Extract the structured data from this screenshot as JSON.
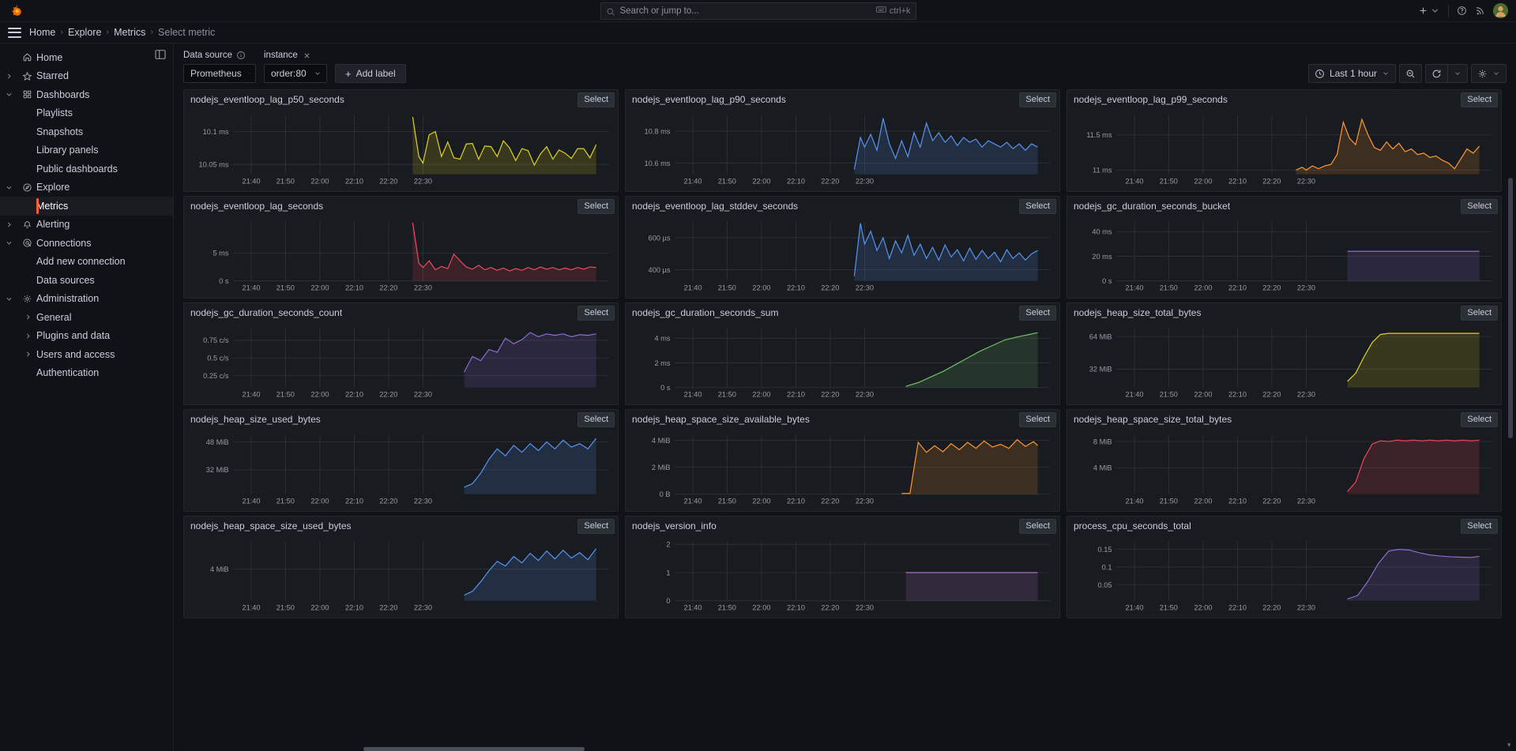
{
  "topbar": {
    "logo_icon": "grafana-logo-icon",
    "search_placeholder": "Search or jump to...",
    "search_icon": "search-icon",
    "kbd_hint": "ctrl+k",
    "kbd_icon": "keyboard-icon",
    "add_icon": "plus-icon",
    "help_icon": "question-circle-icon",
    "news_icon": "rss-icon",
    "avatar_icon": "user-avatar"
  },
  "breadcrumb": {
    "menu_icon": "hamburger-menu-icon",
    "items": [
      {
        "label": "Home",
        "current": false
      },
      {
        "label": "Explore",
        "current": false
      },
      {
        "label": "Metrics",
        "current": false
      },
      {
        "label": "Select metric",
        "current": true
      }
    ],
    "separator": "›"
  },
  "sidebar": {
    "collapse_icon": "dock-menu-icon",
    "items": [
      {
        "label": "Home",
        "icon": "home-icon",
        "level": 1,
        "chevron": "none",
        "active": false
      },
      {
        "label": "Starred",
        "icon": "star-icon",
        "level": 1,
        "chevron": "right",
        "active": false
      },
      {
        "label": "Dashboards",
        "icon": "apps-icon",
        "level": 1,
        "chevron": "down",
        "active": false
      },
      {
        "label": "Playlists",
        "icon": "",
        "level": 2,
        "chevron": "none",
        "active": false
      },
      {
        "label": "Snapshots",
        "icon": "",
        "level": 2,
        "chevron": "none",
        "active": false
      },
      {
        "label": "Library panels",
        "icon": "",
        "level": 2,
        "chevron": "none",
        "active": false
      },
      {
        "label": "Public dashboards",
        "icon": "",
        "level": 2,
        "chevron": "none",
        "active": false
      },
      {
        "label": "Explore",
        "icon": "compass-icon",
        "level": 1,
        "chevron": "down",
        "active": false
      },
      {
        "label": "Metrics",
        "icon": "",
        "level": 2,
        "chevron": "none",
        "active": true
      },
      {
        "label": "Alerting",
        "icon": "bell-icon",
        "level": 1,
        "chevron": "right",
        "active": false
      },
      {
        "label": "Connections",
        "icon": "connections-icon",
        "level": 1,
        "chevron": "down",
        "active": false
      },
      {
        "label": "Add new connection",
        "icon": "",
        "level": 2,
        "chevron": "none",
        "active": false
      },
      {
        "label": "Data sources",
        "icon": "",
        "level": 2,
        "chevron": "none",
        "active": false
      },
      {
        "label": "Administration",
        "icon": "gear-icon",
        "level": 1,
        "chevron": "down",
        "active": false
      },
      {
        "label": "General",
        "icon": "",
        "level": 3,
        "chevron": "right",
        "active": false
      },
      {
        "label": "Plugins and data",
        "icon": "",
        "level": 3,
        "chevron": "right",
        "active": false
      },
      {
        "label": "Users and access",
        "icon": "",
        "level": 3,
        "chevron": "right",
        "active": false
      },
      {
        "label": "Authentication",
        "icon": "",
        "level": 2,
        "chevron": "none",
        "active": false
      }
    ]
  },
  "controls": {
    "datasource_label": "Data source",
    "datasource_info_icon": "info-circle-icon",
    "datasource_value": "Prometheus",
    "instance_label": "instance",
    "instance_remove_icon": "close-icon",
    "instance_value": "order:80",
    "add_label_button": "Add label",
    "add_label_icon": "plus-icon",
    "time_range": "Last 1 hour",
    "time_icon": "clock-icon",
    "zoom_out_icon": "zoom-out-icon",
    "refresh_icon": "refresh-icon",
    "settings_icon": "gear-icon"
  },
  "panel_select_label": "Select",
  "chart_data": [
    {
      "type": "area",
      "title": "nodejs_eventloop_lag_p50_seconds",
      "color": "#e0d321",
      "ylabel": "",
      "xlabel": "",
      "yticks": [
        "10.05 ms",
        "10.1 ms"
      ],
      "ytick_values": [
        10.05,
        10.1
      ],
      "ylim": [
        10.035,
        10.125
      ],
      "xticks": [
        "21:40",
        "21:50",
        "22:00",
        "22:10",
        "22:20",
        "22:30"
      ],
      "x": [
        22.45,
        22.48,
        22.5,
        22.53,
        22.56,
        22.59,
        22.62,
        22.65,
        22.68,
        22.71,
        22.74,
        22.77,
        22.8,
        22.83,
        22.86,
        22.89,
        22.92,
        22.95,
        22.98,
        23.01,
        23.04,
        23.07,
        23.1,
        23.13,
        23.16,
        23.19,
        23.22,
        23.25,
        23.28,
        23.31,
        23.34
      ],
      "values": [
        10.122,
        10.062,
        10.052,
        10.095,
        10.1,
        10.062,
        10.084,
        10.06,
        10.058,
        10.081,
        10.082,
        10.058,
        10.078,
        10.077,
        10.062,
        10.086,
        10.075,
        10.056,
        10.074,
        10.071,
        10.049,
        10.066,
        10.077,
        10.058,
        10.072,
        10.067,
        10.059,
        10.074,
        10.074,
        10.06,
        10.08
      ]
    },
    {
      "type": "area",
      "title": "nodejs_eventloop_lag_p90_seconds",
      "color": "#5794f2",
      "ylabel": "",
      "xlabel": "",
      "yticks": [
        "10.6 ms",
        "10.8 ms"
      ],
      "ytick_values": [
        10.6,
        10.8
      ],
      "ylim": [
        10.53,
        10.9
      ],
      "xticks": [
        "21:40",
        "21:50",
        "22:00",
        "22:10",
        "22:20",
        "22:30"
      ],
      "x": [
        22.45,
        22.48,
        22.5,
        22.53,
        22.56,
        22.59,
        22.62,
        22.65,
        22.68,
        22.71,
        22.74,
        22.77,
        22.8,
        22.83,
        22.86,
        22.89,
        22.92,
        22.95,
        22.98,
        23.01,
        23.04,
        23.07,
        23.1,
        23.13,
        23.16,
        23.19,
        23.22,
        23.25,
        23.28,
        23.31,
        23.34
      ],
      "values": [
        10.56,
        10.76,
        10.7,
        10.78,
        10.68,
        10.88,
        10.72,
        10.63,
        10.74,
        10.64,
        10.79,
        10.7,
        10.85,
        10.74,
        10.79,
        10.73,
        10.77,
        10.71,
        10.76,
        10.73,
        10.75,
        10.7,
        10.74,
        10.72,
        10.7,
        10.73,
        10.69,
        10.72,
        10.68,
        10.72,
        10.7
      ]
    },
    {
      "type": "area",
      "title": "nodejs_eventloop_lag_p99_seconds",
      "color": "#ff9830",
      "ylabel": "",
      "xlabel": "",
      "yticks": [
        "11 ms",
        "11.5 ms"
      ],
      "ytick_values": [
        11,
        11.5
      ],
      "ylim": [
        10.94,
        11.78
      ],
      "xticks": [
        "21:40",
        "21:50",
        "22:00",
        "22:10",
        "22:20",
        "22:30"
      ],
      "x": [
        22.45,
        22.48,
        22.5,
        22.53,
        22.56,
        22.59,
        22.62,
        22.65,
        22.68,
        22.71,
        22.74,
        22.77,
        22.8,
        22.83,
        22.86,
        22.89,
        22.92,
        22.95,
        22.98,
        23.01,
        23.04,
        23.07,
        23.1,
        23.13,
        23.16,
        23.19,
        23.22,
        23.25,
        23.28,
        23.31,
        23.34
      ],
      "values": [
        11.0,
        11.04,
        11.0,
        11.06,
        11.02,
        11.06,
        11.08,
        11.22,
        11.68,
        11.45,
        11.36,
        11.72,
        11.5,
        11.32,
        11.28,
        11.4,
        11.3,
        11.38,
        11.26,
        11.3,
        11.22,
        11.24,
        11.18,
        11.2,
        11.14,
        11.1,
        11.02,
        11.16,
        11.3,
        11.24,
        11.34
      ]
    },
    {
      "type": "area",
      "title": "nodejs_eventloop_lag_seconds",
      "color": "#f2495c",
      "ylabel": "",
      "xlabel": "",
      "yticks": [
        "0 s",
        "5 ms"
      ],
      "ytick_values": [
        0,
        5
      ],
      "ylim": [
        0,
        10.6
      ],
      "xticks": [
        "21:40",
        "21:50",
        "22:00",
        "22:10",
        "22:20",
        "22:30"
      ],
      "x": [
        22.45,
        22.48,
        22.5,
        22.53,
        22.56,
        22.59,
        22.62,
        22.65,
        22.68,
        22.71,
        22.74,
        22.77,
        22.8,
        22.83,
        22.86,
        22.89,
        22.92,
        22.95,
        22.98,
        23.01,
        23.04,
        23.07,
        23.1,
        23.13,
        23.16,
        23.19,
        23.22,
        23.25,
        23.28,
        23.31,
        23.34
      ],
      "values": [
        10.4,
        3.2,
        2.4,
        3.6,
        2.0,
        2.6,
        2.2,
        4.8,
        3.6,
        2.5,
        2.1,
        2.8,
        2.0,
        2.4,
        1.9,
        2.3,
        1.8,
        2.2,
        1.9,
        2.4,
        2.0,
        2.5,
        2.1,
        2.4,
        2.0,
        2.3,
        2.0,
        2.4,
        2.1,
        2.5,
        2.4
      ]
    },
    {
      "type": "area",
      "title": "nodejs_eventloop_lag_stddev_seconds",
      "color": "#5794f2",
      "ylabel": "",
      "xlabel": "",
      "yticks": [
        "400 µs",
        "600 µs"
      ],
      "ytick_values": [
        400,
        600
      ],
      "ylim": [
        330,
        700
      ],
      "xticks": [
        "21:40",
        "21:50",
        "22:00",
        "22:10",
        "22:20",
        "22:30"
      ],
      "x": [
        22.45,
        22.48,
        22.5,
        22.53,
        22.56,
        22.59,
        22.62,
        22.65,
        22.68,
        22.71,
        22.74,
        22.77,
        22.8,
        22.83,
        22.86,
        22.89,
        22.92,
        22.95,
        22.98,
        23.01,
        23.04,
        23.07,
        23.1,
        23.13,
        23.16,
        23.19,
        23.22,
        23.25,
        23.28,
        23.31,
        23.34
      ],
      "values": [
        360,
        690,
        560,
        640,
        520,
        600,
        470,
        580,
        505,
        615,
        490,
        560,
        470,
        540,
        460,
        555,
        480,
        525,
        455,
        535,
        465,
        520,
        470,
        510,
        450,
        525,
        470,
        505,
        460,
        500,
        520
      ]
    },
    {
      "type": "area",
      "title": "nodejs_gc_duration_seconds_bucket",
      "color": "#8f6ad6",
      "ylabel": "",
      "xlabel": "",
      "yticks": [
        "0 s",
        "20 ms",
        "40 ms"
      ],
      "ytick_values": [
        0,
        20,
        40
      ],
      "ylim": [
        0,
        48
      ],
      "xticks": [
        "21:40",
        "21:50",
        "22:00",
        "22:10",
        "22:20",
        "22:30"
      ],
      "x": [
        22.7,
        23.34
      ],
      "values": [
        24,
        24
      ]
    },
    {
      "type": "area",
      "title": "nodejs_gc_duration_seconds_count",
      "color": "#8f6ad6",
      "ylabel": "",
      "xlabel": "",
      "yticks": [
        "0.25 c/s",
        "0.5 c/s",
        "0.75 c/s"
      ],
      "ytick_values": [
        0.25,
        0.5,
        0.75
      ],
      "ylim": [
        0.08,
        0.92
      ],
      "xticks": [
        "21:40",
        "21:50",
        "22:00",
        "22:10",
        "22:20",
        "22:30"
      ],
      "x": [
        22.7,
        22.74,
        22.78,
        22.82,
        22.86,
        22.9,
        22.94,
        22.98,
        23.02,
        23.06,
        23.1,
        23.14,
        23.18,
        23.22,
        23.26,
        23.3,
        23.34
      ],
      "values": [
        0.3,
        0.52,
        0.46,
        0.62,
        0.58,
        0.78,
        0.7,
        0.76,
        0.86,
        0.8,
        0.84,
        0.82,
        0.84,
        0.8,
        0.83,
        0.82,
        0.84
      ]
    },
    {
      "type": "area",
      "title": "nodejs_gc_duration_seconds_sum",
      "color": "#73bf69",
      "ylabel": "",
      "xlabel": "",
      "yticks": [
        "0 s",
        "2 ms",
        "4 ms"
      ],
      "ytick_values": [
        0,
        2,
        4
      ],
      "ylim": [
        0,
        4.8
      ],
      "xticks": [
        "21:40",
        "21:50",
        "22:00",
        "22:10",
        "22:20",
        "22:30"
      ],
      "x": [
        22.7,
        22.76,
        22.82,
        22.88,
        22.94,
        23.0,
        23.06,
        23.12,
        23.18,
        23.24,
        23.3,
        23.34
      ],
      "values": [
        0.1,
        0.4,
        0.85,
        1.3,
        1.85,
        2.4,
        2.95,
        3.4,
        3.85,
        4.1,
        4.3,
        4.45
      ]
    },
    {
      "type": "area",
      "title": "nodejs_heap_size_total_bytes",
      "color": "#e0d321",
      "ylabel": "",
      "xlabel": "",
      "yticks": [
        "32 MiB",
        "64 MiB"
      ],
      "ytick_values": [
        32,
        64
      ],
      "ylim": [
        14,
        72
      ],
      "xticks": [
        "21:40",
        "21:50",
        "22:00",
        "22:10",
        "22:20",
        "22:30"
      ],
      "x": [
        22.7,
        22.74,
        22.78,
        22.82,
        22.86,
        22.9,
        22.94,
        22.98,
        23.02,
        23.06,
        23.1,
        23.14,
        23.18,
        23.22,
        23.26,
        23.3,
        23.34
      ],
      "values": [
        20,
        28,
        44,
        58,
        66,
        67,
        67,
        67,
        67,
        67,
        67,
        67,
        67,
        67,
        67,
        67,
        67
      ]
    },
    {
      "type": "area",
      "title": "nodejs_heap_size_used_bytes",
      "color": "#5794f2",
      "ylabel": "",
      "xlabel": "",
      "yticks": [
        "32 MiB",
        "48 MiB"
      ],
      "ytick_values": [
        32,
        48
      ],
      "ylim": [
        18,
        52
      ],
      "xticks": [
        "21:40",
        "21:50",
        "22:00",
        "22:10",
        "22:20",
        "22:30"
      ],
      "x": [
        22.7,
        22.74,
        22.78,
        22.82,
        22.86,
        22.9,
        22.94,
        22.98,
        23.02,
        23.06,
        23.1,
        23.14,
        23.18,
        23.22,
        23.26,
        23.3,
        23.34
      ],
      "values": [
        22,
        24,
        30,
        38,
        44,
        40,
        46,
        42,
        47,
        43,
        48,
        44,
        49,
        45,
        47,
        44,
        50
      ]
    },
    {
      "type": "area",
      "title": "nodejs_heap_space_size_available_bytes",
      "color": "#ff9830",
      "ylabel": "",
      "xlabel": "",
      "yticks": [
        "0 B",
        "2 MiB",
        "4 MiB"
      ],
      "ytick_values": [
        0,
        2,
        4
      ],
      "ylim": [
        0,
        4.4
      ],
      "xticks": [
        "21:40",
        "21:50",
        "22:00",
        "22:10",
        "22:20",
        "22:30"
      ],
      "x": [
        22.68,
        22.72,
        22.76,
        22.8,
        22.84,
        22.88,
        22.92,
        22.96,
        23.0,
        23.04,
        23.08,
        23.12,
        23.16,
        23.2,
        23.24,
        23.28,
        23.32,
        23.34
      ],
      "values": [
        0.05,
        0.05,
        3.85,
        3.1,
        3.6,
        3.15,
        3.75,
        3.3,
        3.85,
        3.4,
        3.95,
        3.5,
        3.7,
        3.4,
        4.05,
        3.55,
        3.9,
        3.6
      ]
    },
    {
      "type": "area",
      "title": "nodejs_heap_space_size_total_bytes",
      "color": "#f2495c",
      "ylabel": "",
      "xlabel": "",
      "yticks": [
        "4 MiB",
        "8 MiB"
      ],
      "ytick_values": [
        4,
        8
      ],
      "ylim": [
        0,
        9
      ],
      "xticks": [
        "21:40",
        "21:50",
        "22:00",
        "22:10",
        "22:20",
        "22:30"
      ],
      "x": [
        22.7,
        22.74,
        22.78,
        22.82,
        22.86,
        22.9,
        22.94,
        22.98,
        23.02,
        23.06,
        23.1,
        23.14,
        23.18,
        23.22,
        23.26,
        23.3,
        23.34
      ],
      "values": [
        0.4,
        1.8,
        5.4,
        7.6,
        8.1,
        8.0,
        8.2,
        8.1,
        8.2,
        8.1,
        8.2,
        8.1,
        8.2,
        8.1,
        8.2,
        8.1,
        8.2
      ]
    },
    {
      "type": "area",
      "title": "nodejs_heap_space_size_used_bytes",
      "color": "#5794f2",
      "ylabel": "",
      "xlabel": "",
      "yticks": [
        "4 MiB"
      ],
      "ytick_values": [
        4
      ],
      "ylim": [
        0,
        7.5
      ],
      "xticks": [
        "21:40",
        "21:50",
        "22:00",
        "22:10",
        "22:20",
        "22:30"
      ],
      "x": [
        22.7,
        22.74,
        22.78,
        22.82,
        22.86,
        22.9,
        22.94,
        22.98,
        23.02,
        23.06,
        23.1,
        23.14,
        23.18,
        23.22,
        23.26,
        23.3,
        23.34
      ],
      "values": [
        0.7,
        1.2,
        2.4,
        3.8,
        5.0,
        4.4,
        5.6,
        4.8,
        6.0,
        5.1,
        6.3,
        5.3,
        6.4,
        5.4,
        6.1,
        5.2,
        6.6
      ]
    },
    {
      "type": "area",
      "title": "nodejs_version_info",
      "color": "#b877d9",
      "ylabel": "",
      "xlabel": "",
      "yticks": [
        "0",
        "1",
        "2"
      ],
      "ytick_values": [
        0,
        1,
        2
      ],
      "ylim": [
        0,
        2.1
      ],
      "xticks": [
        "21:40",
        "21:50",
        "22:00",
        "22:10",
        "22:20",
        "22:30"
      ],
      "x": [
        22.7,
        23.34
      ],
      "values": [
        1,
        1
      ]
    },
    {
      "type": "area",
      "title": "process_cpu_seconds_total",
      "color": "#8f6ad6",
      "ylabel": "",
      "xlabel": "",
      "yticks": [
        "0.05",
        "0.1",
        "0.15"
      ],
      "ytick_values": [
        0.05,
        0.1,
        0.15
      ],
      "ylim": [
        0.005,
        0.172
      ],
      "xticks": [
        "21:40",
        "21:50",
        "22:00",
        "22:10",
        "22:20",
        "22:30"
      ],
      "x": [
        22.7,
        22.75,
        22.8,
        22.85,
        22.9,
        22.95,
        23.0,
        23.05,
        23.1,
        23.15,
        23.2,
        23.25,
        23.3,
        23.34
      ],
      "values": [
        0.01,
        0.02,
        0.06,
        0.11,
        0.145,
        0.15,
        0.148,
        0.14,
        0.134,
        0.131,
        0.129,
        0.128,
        0.127,
        0.13
      ]
    }
  ]
}
